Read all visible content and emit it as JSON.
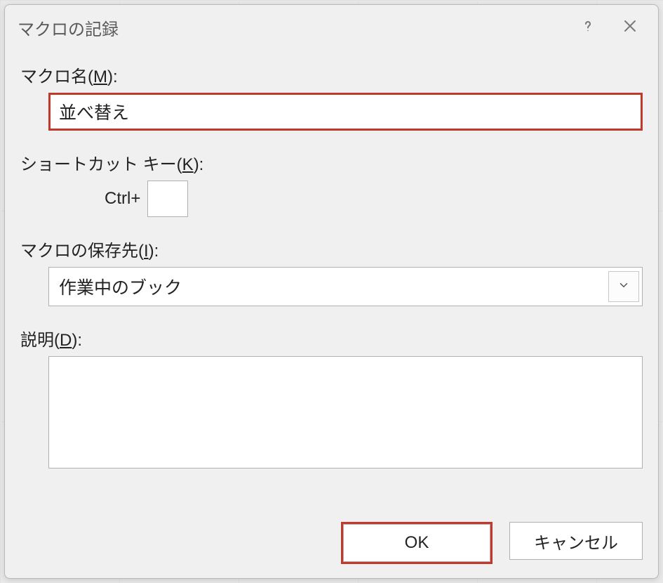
{
  "dialog": {
    "title": "マクロの記録",
    "fields": {
      "macroName": {
        "label_pre": "マクロ名(",
        "label_key": "M",
        "label_post": "):",
        "value": "並べ替え"
      },
      "shortcut": {
        "label_pre": "ショートカット キー(",
        "label_key": "K",
        "label_post": "):",
        "prefix": "Ctrl+",
        "value": ""
      },
      "storeIn": {
        "label_pre": "マクロの保存先(",
        "label_key": "I",
        "label_post": "):",
        "selected": "作業中のブック"
      },
      "description": {
        "label_pre": "説明(",
        "label_key": "D",
        "label_post": "):",
        "value": ""
      }
    },
    "buttons": {
      "ok": "OK",
      "cancel": "キャンセル"
    }
  },
  "highlight_color": "#c0392b"
}
